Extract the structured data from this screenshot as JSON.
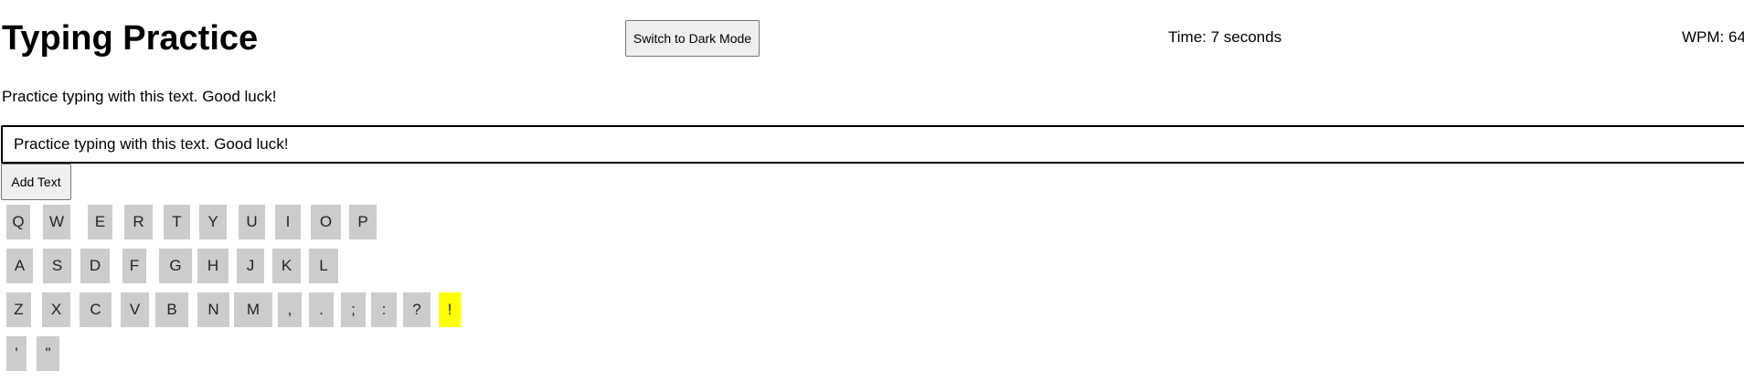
{
  "header": {
    "title": "Typing Practice",
    "mode_button_label": "Switch to Dark Mode",
    "timer_text": "Time: 7 seconds",
    "wpm_text": "WPM: 64"
  },
  "practice": {
    "prompt_text": "Practice typing with this text. Good luck!",
    "input_value": "Practice typing with this text. Good luck!",
    "add_button_label": "Add Text"
  },
  "keyboard": {
    "highlight_color": "#ffff00",
    "key_color": "#cccccc",
    "active_key": "!",
    "rows": [
      [
        "Q",
        "W",
        "E",
        "R",
        "T",
        "Y",
        "U",
        "I",
        "O",
        "P"
      ],
      [
        "A",
        "S",
        "D",
        "F",
        "G",
        "H",
        "J",
        "K",
        "L"
      ],
      [
        "Z",
        "X",
        "C",
        "V",
        "B",
        "N",
        "M",
        ",",
        ".",
        ";",
        ":",
        "?",
        "!"
      ],
      [
        "'",
        "\""
      ]
    ]
  }
}
